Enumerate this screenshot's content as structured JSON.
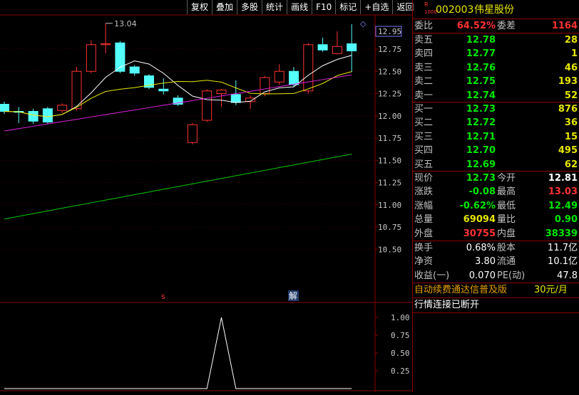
{
  "toolbar": [
    "复权",
    "叠加",
    "多股",
    "统计",
    "画线",
    "F10",
    "标记",
    "+自选",
    "返回"
  ],
  "header": {
    "badge_top": "R",
    "badge_bottom": "1000",
    "code": "002003",
    "name": "伟星股份"
  },
  "chart": {
    "price_axis": [
      "12.95",
      "12.75",
      "12.50",
      "12.25",
      "12.00",
      "11.75",
      "11.50",
      "11.25",
      "11.00",
      "10.75",
      "10.50"
    ],
    "current_price_label": "12.95",
    "high_mark": "13.04",
    "event_marks": [
      "s",
      "解"
    ],
    "indicator_axis": [
      "1.00",
      "0.75",
      "0.50",
      "0.25"
    ],
    "candles": [
      {
        "o": 12.13,
        "c": 12.05,
        "h": 12.16,
        "l": 12.02
      },
      {
        "o": 12.05,
        "c": 12.04,
        "h": 12.1,
        "l": 11.92
      },
      {
        "o": 12.05,
        "c": 11.94,
        "h": 12.08,
        "l": 11.91
      },
      {
        "o": 12.08,
        "c": 11.93,
        "h": 12.1,
        "l": 11.91
      },
      {
        "o": 12.06,
        "c": 12.12,
        "h": 12.14,
        "l": 12.03
      },
      {
        "o": 12.08,
        "c": 12.5,
        "h": 12.55,
        "l": 12.06
      },
      {
        "o": 12.5,
        "c": 12.8,
        "h": 12.85,
        "l": 12.48
      },
      {
        "o": 12.8,
        "c": 12.81,
        "h": 13.04,
        "l": 12.7
      },
      {
        "o": 12.82,
        "c": 12.5,
        "h": 12.84,
        "l": 12.48
      },
      {
        "o": 12.55,
        "c": 12.48,
        "h": 12.57,
        "l": 12.45
      },
      {
        "o": 12.45,
        "c": 12.32,
        "h": 12.47,
        "l": 12.3
      },
      {
        "o": 12.3,
        "c": 12.28,
        "h": 12.42,
        "l": 12.24
      },
      {
        "o": 12.2,
        "c": 12.13,
        "h": 12.23,
        "l": 12.11
      },
      {
        "o": 11.7,
        "c": 11.9,
        "h": 11.92,
        "l": 11.68
      },
      {
        "o": 11.95,
        "c": 12.28,
        "h": 12.3,
        "l": 11.93
      },
      {
        "o": 12.25,
        "c": 12.29,
        "h": 12.3,
        "l": 12.1
      },
      {
        "o": 12.24,
        "c": 12.15,
        "h": 12.4,
        "l": 12.12
      },
      {
        "o": 12.16,
        "c": 12.2,
        "h": 12.23,
        "l": 12.08
      },
      {
        "o": 12.25,
        "c": 12.43,
        "h": 12.45,
        "l": 12.22
      },
      {
        "o": 12.38,
        "c": 12.5,
        "h": 12.58,
        "l": 12.35
      },
      {
        "o": 12.5,
        "c": 12.35,
        "h": 12.55,
        "l": 12.33
      },
      {
        "o": 12.28,
        "c": 12.8,
        "h": 12.82,
        "l": 12.25
      },
      {
        "o": 12.8,
        "c": 12.74,
        "h": 12.88,
        "l": 12.72
      },
      {
        "o": 12.7,
        "c": 12.78,
        "h": 12.95,
        "l": 12.69
      },
      {
        "o": 12.81,
        "c": 12.73,
        "h": 13.03,
        "l": 12.49
      }
    ],
    "indicator_values": [
      0,
      0,
      0,
      0,
      0,
      0,
      0,
      0,
      0,
      0,
      0,
      0,
      0,
      0,
      0,
      1,
      0,
      0,
      0,
      0,
      0,
      0,
      0,
      0,
      0
    ]
  },
  "quote": {
    "weibi": {
      "label": "委比",
      "value": "64.52%"
    },
    "weicha": {
      "label": "委差",
      "value": "1164"
    },
    "asks": [
      {
        "label": "卖五",
        "price": "12.78",
        "vol": "28"
      },
      {
        "label": "卖四",
        "price": "12.77",
        "vol": "1"
      },
      {
        "label": "卖三",
        "price": "12.76",
        "vol": "46"
      },
      {
        "label": "卖二",
        "price": "12.75",
        "vol": "193"
      },
      {
        "label": "卖一",
        "price": "12.74",
        "vol": "52"
      }
    ],
    "bids": [
      {
        "label": "买一",
        "price": "12.73",
        "vol": "876"
      },
      {
        "label": "买二",
        "price": "12.72",
        "vol": "36"
      },
      {
        "label": "买三",
        "price": "12.71",
        "vol": "15"
      },
      {
        "label": "买四",
        "price": "12.70",
        "vol": "495"
      },
      {
        "label": "买五",
        "price": "12.69",
        "vol": "62"
      }
    ],
    "stats": [
      {
        "l1": "现价",
        "v1": "12.73",
        "c1": "green",
        "l2": "今开",
        "v2": "12.81",
        "c2": "white"
      },
      {
        "l1": "涨跌",
        "v1": "-0.08",
        "c1": "green",
        "l2": "最高",
        "v2": "13.03",
        "c2": "red"
      },
      {
        "l1": "涨幅",
        "v1": "-0.62%",
        "c1": "green",
        "l2": "最低",
        "v2": "12.49",
        "c2": "green"
      },
      {
        "l1": "总量",
        "v1": "69094",
        "c1": "yellow",
        "l2": "量比",
        "v2": "0.90",
        "c2": "green"
      },
      {
        "l1": "外盘",
        "v1": "30755",
        "c1": "red",
        "l2": "内盘",
        "v2": "38339",
        "c2": "green"
      }
    ],
    "finance": [
      {
        "l1": "换手",
        "v1": "0.68%",
        "l2": "股本",
        "v2": "11.7亿"
      },
      {
        "l1": "净资",
        "v1": "3.80",
        "l2": "流通",
        "v2": "10.1亿"
      },
      {
        "l1": "收益(一)",
        "v1": "0.070",
        "l2": "PE(动)",
        "v2": "47.8"
      }
    ],
    "promo": {
      "text": "自动续费通达信普及版",
      "price": "30元/月"
    },
    "status": "行情连接已断开"
  },
  "colors": {
    "up": "#ff3232",
    "down": "#54ffff",
    "ma5": "#ffffff",
    "ma10": "#e6e600",
    "ma20": "#e020e0",
    "ma60": "#00c800",
    "grid": "#8b0000"
  }
}
